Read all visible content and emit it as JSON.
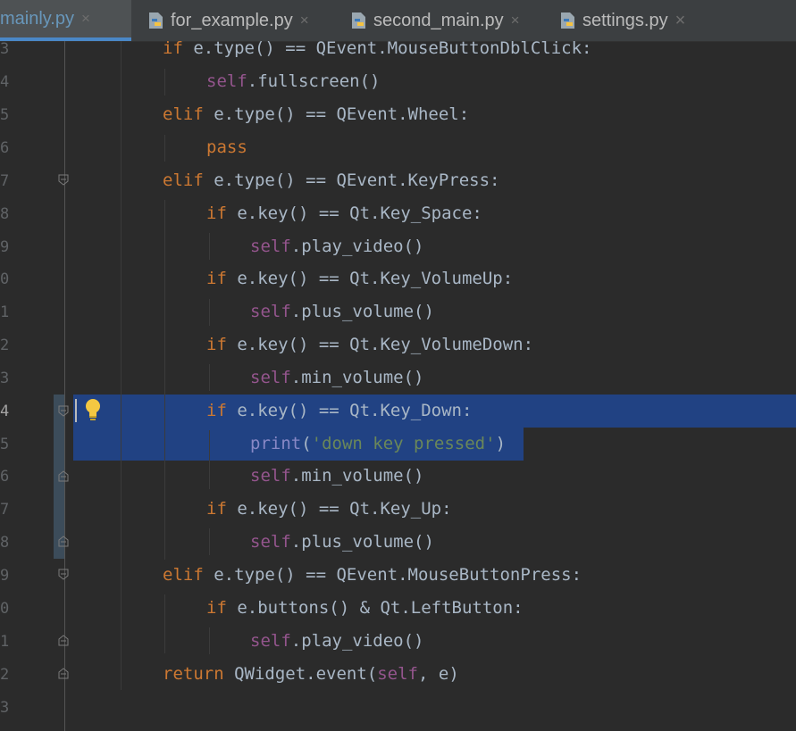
{
  "colors": {
    "editor_bg": "#2b2b2b",
    "keyword": "#cc7832",
    "self": "#94558d",
    "string": "#6a8759",
    "text": "#a9b7c6",
    "selection": "#214283",
    "active_tab_text": "#6897bb"
  },
  "tabs": [
    {
      "label": "mainly.py",
      "icon": "python-file-icon",
      "active": true,
      "close": "×"
    },
    {
      "label": "for_example.py",
      "icon": "python-file-icon",
      "active": false,
      "close": "×"
    },
    {
      "label": "second_main.py",
      "icon": "python-file-icon",
      "active": false,
      "close": "×"
    },
    {
      "label": "settings.py",
      "icon": "python-file-icon",
      "active": false,
      "close": ""
    }
  ],
  "line_numbers": [
    "3",
    "4",
    "5",
    "6",
    "7",
    "8",
    "9",
    "0",
    "1",
    "2",
    "3",
    "4",
    "5",
    "6",
    "7",
    "8",
    "9",
    "0",
    "1",
    "2",
    "3"
  ],
  "current_line_index": 11,
  "code": {
    "l0": {
      "a": "if",
      "b": " e.type() == QEvent.MouseButtonDblClick:"
    },
    "l1": {
      "a": "self",
      "b": ".fullscreen()"
    },
    "l2": {
      "a": "elif",
      "b": " e.type() == QEvent.Wheel:"
    },
    "l3": {
      "a": "pass"
    },
    "l4": {
      "a": "elif",
      "b": " e.type() == QEvent.KeyPress:"
    },
    "l5": {
      "a": "if",
      "b": " e.key() == Qt.Key_Space:"
    },
    "l6": {
      "a": "self",
      "b": ".play_video()"
    },
    "l7": {
      "a": "if",
      "b": " e.key() == Qt.Key_VolumeUp:"
    },
    "l8": {
      "a": "self",
      "b": ".plus_volume()"
    },
    "l9": {
      "a": "if",
      "b": " e.key() == Qt.Key_VolumeDown:"
    },
    "l10": {
      "a": "self",
      "b": ".min_volume()"
    },
    "l11": {
      "a": "if",
      "b": " e.key() == Qt.Key_Down:"
    },
    "l12": {
      "a": "print",
      "b": "(",
      "c": "'down key pressed'",
      "d": ")"
    },
    "l13": {
      "a": "self",
      "b": ".min_volume()"
    },
    "l14": {
      "a": "if",
      "b": " e.key() == Qt.Key_Up:"
    },
    "l15": {
      "a": "self",
      "b": ".plus_volume()"
    },
    "l16": {
      "a": "elif",
      "b": " e.type() == QEvent.MouseButtonPress:"
    },
    "l17": {
      "a": "if",
      "b": " e.buttons() & Qt.LeftButton:"
    },
    "l18": {
      "a": "self",
      "b": ".play_video()"
    },
    "l19": {
      "a": "return",
      "b": " QWidget.event(",
      "c": "self",
      "d": ", e)"
    }
  },
  "intention_action_icon": "lightbulb-icon"
}
